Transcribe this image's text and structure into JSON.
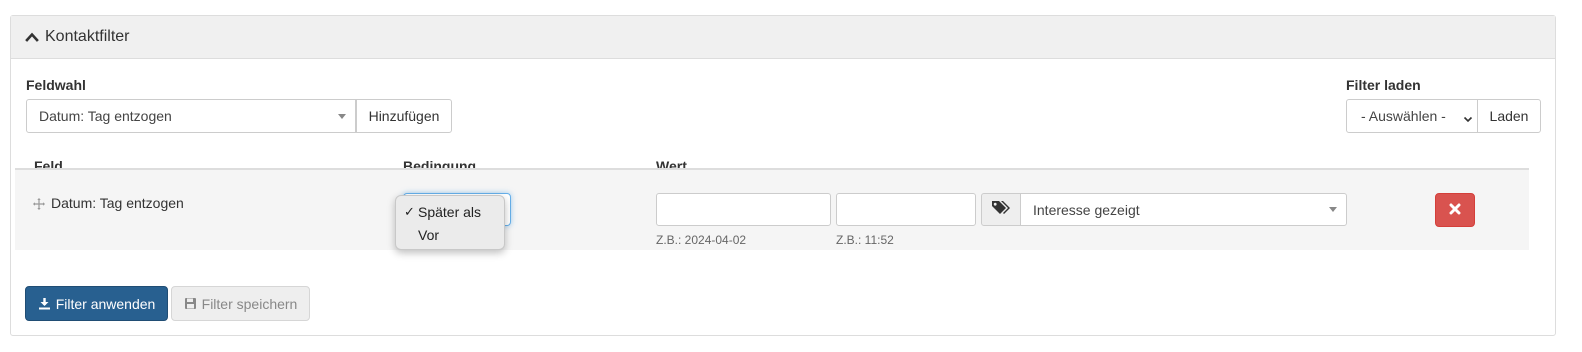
{
  "panel": {
    "title": "Kontaktfilter"
  },
  "field_select": {
    "label": "Feldwahl",
    "value": "Datum: Tag entzogen",
    "add_button": "Hinzufügen"
  },
  "load_filter": {
    "label": "Filter laden",
    "select_value": "- Auswählen -",
    "load_button": "Laden"
  },
  "table": {
    "headers": {
      "field": "Feld",
      "condition": "Bedingung",
      "value": "Wert"
    },
    "row": {
      "field": "Datum: Tag entzogen",
      "condition_options": [
        "Später als",
        "Vor"
      ],
      "condition_selected": "Später als",
      "date_value": "",
      "date_hint": "Z.B.: 2024-04-02",
      "time_value": "",
      "time_hint": "Z.B.: 11:52",
      "tag_value": "Interesse gezeigt"
    }
  },
  "actions": {
    "apply": "Filter anwenden",
    "save": "Filter speichern"
  },
  "icons": {
    "heading": "chevron-up-icon",
    "drag": "move-icon",
    "tag": "tags-icon",
    "remove": "close-icon",
    "apply": "download-icon",
    "save": "floppy-disk-icon"
  },
  "colors": {
    "primary": "#286090",
    "danger": "#d9534f",
    "heading_bg": "#f0f0f0",
    "row_bg": "#f5f5f5"
  }
}
